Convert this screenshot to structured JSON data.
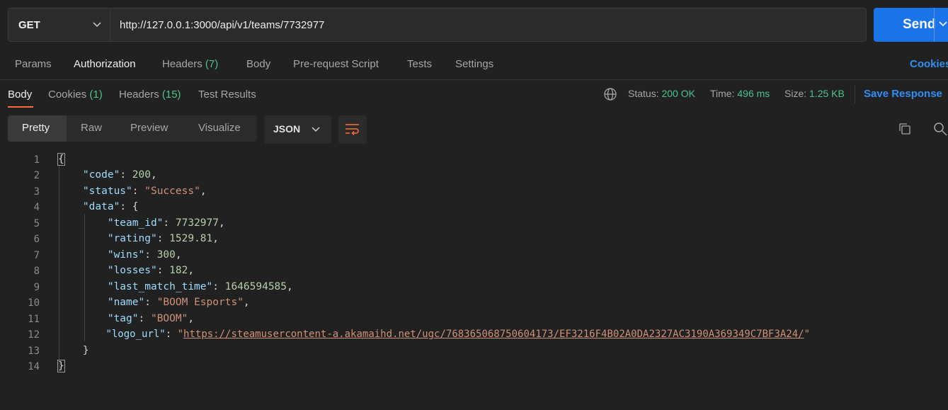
{
  "request": {
    "method": "GET",
    "url": "http://127.0.0.1:3000/api/v1/teams/7732977",
    "send_label": "Send"
  },
  "request_tabs": [
    {
      "label": "Params"
    },
    {
      "label": "Authorization"
    },
    {
      "label": "Headers",
      "count": "(7)"
    },
    {
      "label": "Body"
    },
    {
      "label": "Pre-request Script"
    },
    {
      "label": "Tests"
    },
    {
      "label": "Settings"
    }
  ],
  "cookies_link": "Cookies",
  "response_tabs": [
    {
      "label": "Body"
    },
    {
      "label": "Cookies",
      "count": "(1)"
    },
    {
      "label": "Headers",
      "count": "(15)"
    },
    {
      "label": "Test Results"
    }
  ],
  "response_status": {
    "status_label": "Status:",
    "status_value": "200 OK",
    "time_label": "Time:",
    "time_value": "496 ms",
    "size_label": "Size:",
    "size_value": "1.25 KB",
    "save_label": "Save Response"
  },
  "view_modes": [
    "Pretty",
    "Raw",
    "Preview",
    "Visualize"
  ],
  "format": "JSON",
  "code_lines": [
    "1",
    "2",
    "3",
    "4",
    "5",
    "6",
    "7",
    "8",
    "9",
    "10",
    "11",
    "12",
    "13",
    "14"
  ],
  "json_body": {
    "open_brace": "{",
    "code_key": "\"code\"",
    "code_val": "200",
    "status_key": "\"status\"",
    "status_val": "\"Success\"",
    "data_key": "\"data\"",
    "team_id_key": "\"team_id\"",
    "team_id_val": "7732977",
    "rating_key": "\"rating\"",
    "rating_val": "1529.81",
    "wins_key": "\"wins\"",
    "wins_val": "300",
    "losses_key": "\"losses\"",
    "losses_val": "182",
    "last_match_time_key": "\"last_match_time\"",
    "last_match_time_val": "1646594585",
    "name_key": "\"name\"",
    "name_val": "\"BOOM Esports\"",
    "tag_key": "\"tag\"",
    "tag_val": "\"BOOM\"",
    "logo_url_key": "\"logo_url\"",
    "logo_url_val": "https://steamusercontent-a.akamaihd.net/ugc/768365068750604173/EF3216F4B02A0DA2327AC3190A369349C7BF3A24/",
    "data_close": "}",
    "close_brace": "}"
  },
  "colors": {
    "accent_orange": "#ff6c37",
    "send_blue": "#1a73e8",
    "status_green": "#4cc38a",
    "link_blue": "#2f8ff3"
  }
}
